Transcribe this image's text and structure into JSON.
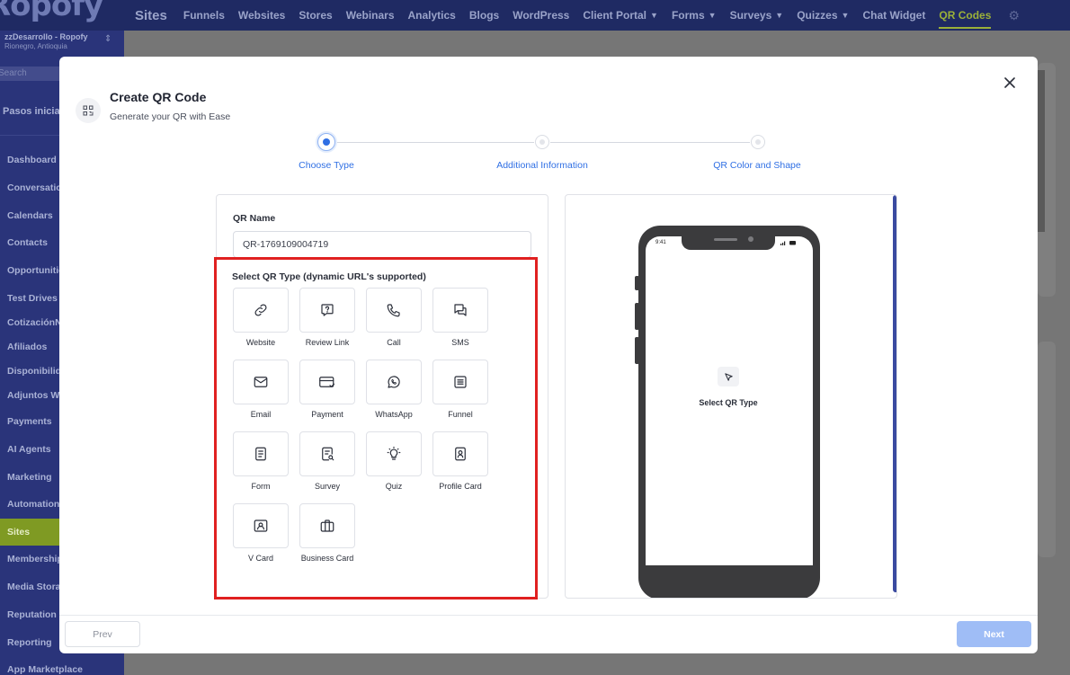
{
  "app": {
    "logo_text": "Ropofy",
    "section_title": "Sites",
    "nav": [
      {
        "label": "Funnels"
      },
      {
        "label": "Websites"
      },
      {
        "label": "Stores"
      },
      {
        "label": "Webinars"
      },
      {
        "label": "Analytics"
      },
      {
        "label": "Blogs"
      },
      {
        "label": "WordPress"
      },
      {
        "label": "Client Portal"
      },
      {
        "label": "Forms"
      },
      {
        "label": "Surveys"
      },
      {
        "label": "Quizzes"
      },
      {
        "label": "Chat Widget"
      },
      {
        "label": "QR Codes"
      }
    ],
    "account_name": "zzDesarrollo - Ropofy",
    "account_location": "Rionegro, Antioquia",
    "search_placeholder": "Search",
    "pasos_label": "Pasos iniciales",
    "sidebar": [
      {
        "label": "Dashboard"
      },
      {
        "label": "Conversations"
      },
      {
        "label": "Calendars"
      },
      {
        "label": "Contacts"
      },
      {
        "label": "Opportunities"
      },
      {
        "label": "Test Drives"
      },
      {
        "label": "CotizaciónNes"
      },
      {
        "label": "Afiliados"
      },
      {
        "label": "Disponibilidad"
      },
      {
        "label": "Adjuntos WA"
      },
      {
        "label": "Payments"
      },
      {
        "label": "AI Agents"
      },
      {
        "label": "Marketing"
      },
      {
        "label": "Automation"
      },
      {
        "label": "Sites"
      },
      {
        "label": "Memberships"
      },
      {
        "label": "Media Storage"
      },
      {
        "label": "Reputation"
      },
      {
        "label": "Reporting"
      },
      {
        "label": "App Marketplace"
      }
    ],
    "colors": {
      "topbar": "#1f2a63",
      "sidebar": "#2a347a",
      "active_green": "#7f9a23",
      "accent_blue": "#2f6fe4",
      "highlight_red": "#e02020"
    }
  },
  "modal": {
    "title": "Create QR Code",
    "subtitle": "Generate your QR with Ease",
    "steps": [
      {
        "label": "Choose Type"
      },
      {
        "label": "Additional Information"
      },
      {
        "label": "QR Color and Shape"
      }
    ],
    "qr_name_label": "QR Name",
    "qr_name_value": "QR-1769109004719",
    "select_type_label": "Select QR Type (dynamic URL's supported)",
    "types": [
      {
        "label": "Website",
        "icon": "link-icon"
      },
      {
        "label": "Review Link",
        "icon": "review-icon"
      },
      {
        "label": "Call",
        "icon": "phone-icon"
      },
      {
        "label": "SMS",
        "icon": "chat-icon"
      },
      {
        "label": "Email",
        "icon": "mail-icon"
      },
      {
        "label": "Payment",
        "icon": "card-icon"
      },
      {
        "label": "WhatsApp",
        "icon": "whatsapp-icon"
      },
      {
        "label": "Funnel",
        "icon": "funnel-icon"
      },
      {
        "label": "Form",
        "icon": "form-icon"
      },
      {
        "label": "Survey",
        "icon": "survey-icon"
      },
      {
        "label": "Quiz",
        "icon": "bulb-icon"
      },
      {
        "label": "Profile Card",
        "icon": "profile-icon"
      },
      {
        "label": "V Card",
        "icon": "vcard-icon"
      },
      {
        "label": "Business Card",
        "icon": "briefcase-icon"
      }
    ],
    "preview": {
      "time": "9:41",
      "text": "Select QR Type"
    },
    "prev_label": "Prev",
    "next_label": "Next"
  }
}
